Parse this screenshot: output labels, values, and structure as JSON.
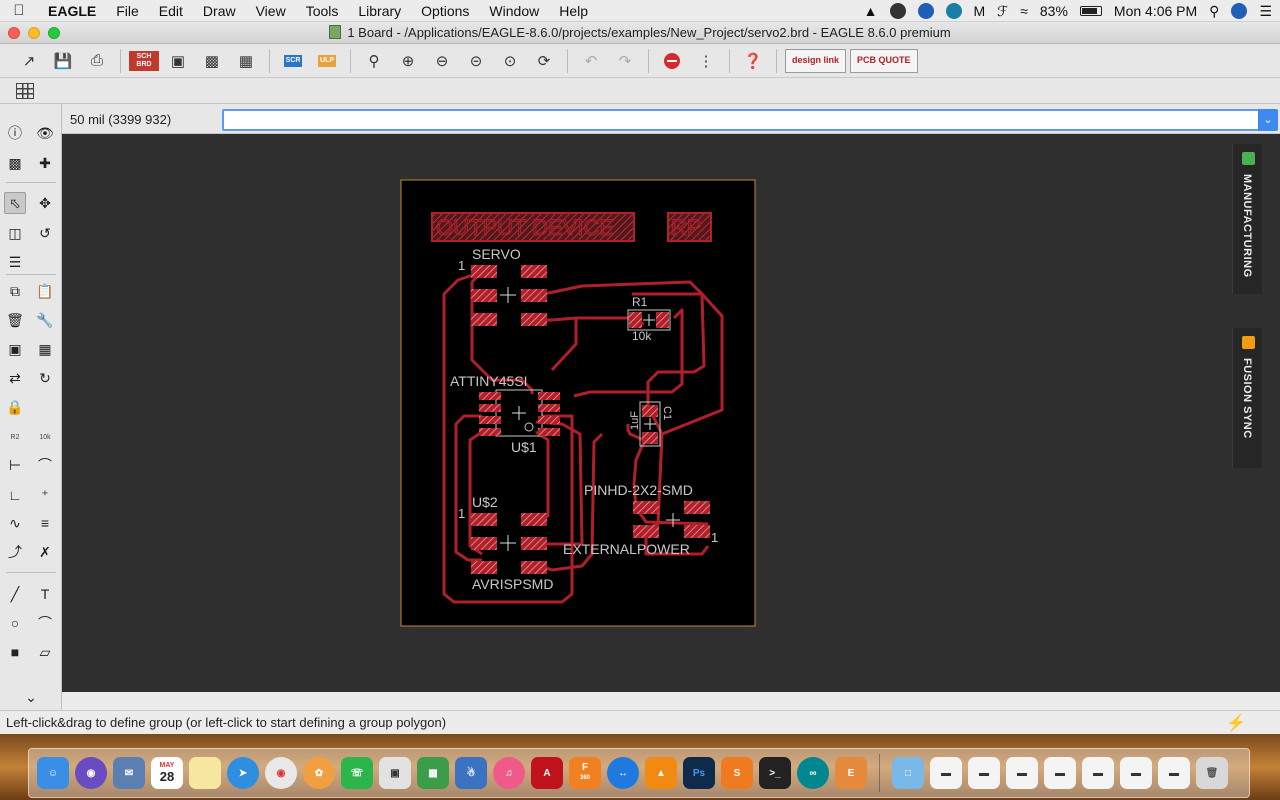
{
  "menubar": {
    "app_name": "EAGLE",
    "items": [
      "File",
      "Edit",
      "Draw",
      "View",
      "Tools",
      "Library",
      "Options",
      "Window",
      "Help"
    ],
    "battery": "83%",
    "clock": "Mon 4:06 PM"
  },
  "window": {
    "title": "1 Board - /Applications/EAGLE-8.6.0/projects/examples/New_Project/servo2.brd - EAGLE 8.6.0 premium"
  },
  "toolbar": {
    "sch_brd_badge": "SCH BRD",
    "scr_badge": "SCR",
    "ulp_badge": "ULP",
    "designlink_label": "design link",
    "pcbquote_label": "PCB QUOTE"
  },
  "command": {
    "coordinates": "50 mil (3399 932)",
    "value": ""
  },
  "tools": {
    "r2_top": "R2",
    "r2_val": "10k"
  },
  "board": {
    "labels": {
      "output_device": "OUTPUT DEVICE",
      "rp": "RP",
      "servo": "SERVO",
      "r1": "R1",
      "r1_value": "10k",
      "attiny": "ATTINY45SI",
      "u1": "U$1",
      "c1": "C1",
      "c1_value": "1uF",
      "pinhd": "PINHD-2X2-SMD",
      "u2": "U$2",
      "external_power": "EXTERNALPOWER",
      "avrisp": "AVRISPSMD",
      "pin1": "1"
    },
    "colors": {
      "background": "#000000",
      "outline": "#c48a2a",
      "trace": "#b0202a",
      "pad": "#b0202a",
      "text": "#c8c8c8"
    }
  },
  "side_tabs": {
    "manufacturing": "MANUFACTURING",
    "fusion_sync": "FUSION SYNC"
  },
  "status": {
    "message": "Left-click&drag to define group (or left-click to start defining a group polygon)"
  },
  "dock": {
    "calendar_month": "MAY",
    "calendar_day": "28",
    "fusion_badge": "360"
  }
}
